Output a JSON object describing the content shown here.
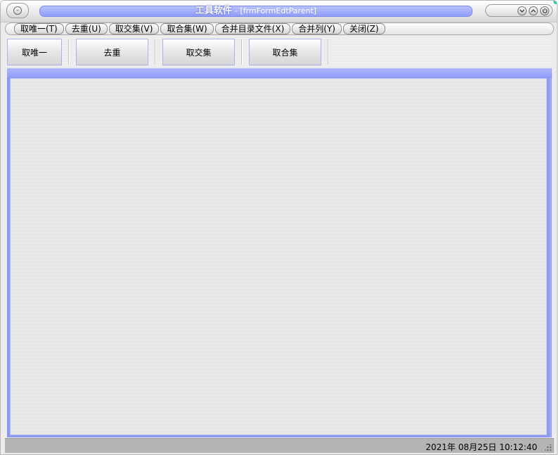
{
  "window": {
    "title": "工具软件",
    "subtitle": "- [frmFormEdtParent]"
  },
  "menu": {
    "items": [
      {
        "label": "取唯一(T)"
      },
      {
        "label": "去重(U)"
      },
      {
        "label": "取交集(V)"
      },
      {
        "label": "取合集(W)"
      },
      {
        "label": "合并目录文件(X)"
      },
      {
        "label": "合并列(Y)"
      },
      {
        "label": "关闭(Z)"
      }
    ]
  },
  "toolbar": {
    "buttons": [
      {
        "label": "取唯一"
      },
      {
        "label": "去重"
      },
      {
        "label": "取交集"
      },
      {
        "label": "取合集"
      }
    ]
  },
  "status": {
    "datetime": "2021年 08月25日 10:12:40"
  },
  "icons": {
    "system": "system-menu-icon",
    "minimize": "chevron-down-icon",
    "maximize": "chevron-up-icon",
    "close": "power-icon"
  },
  "colors": {
    "accent": "#8e9cf7",
    "status_bar": "#b4b4b4"
  }
}
